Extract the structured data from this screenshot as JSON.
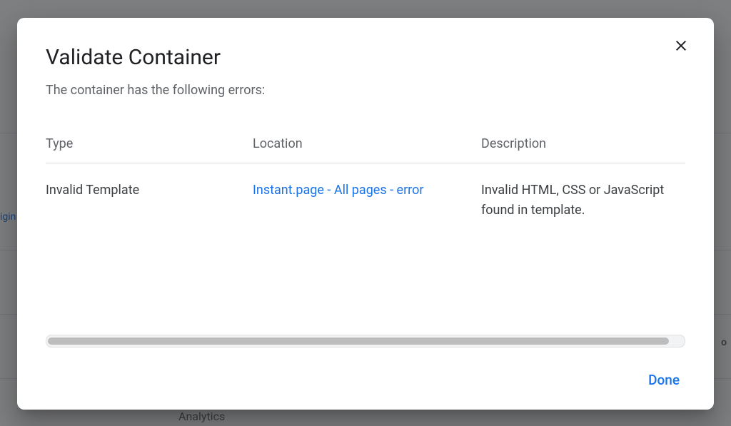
{
  "dialog": {
    "title": "Validate Container",
    "subtitle": "The container has the following errors:",
    "close_label": "Close",
    "headers": {
      "type": "Type",
      "location": "Location",
      "description": "Description"
    },
    "errors": [
      {
        "type": "Invalid Template",
        "location": "Instant.page - All pages - error",
        "description": "Invalid HTML, CSS or JavaScript found in template."
      }
    ],
    "done_label": "Done"
  },
  "background": {
    "left_text": "igin",
    "analytics_label": "Analytics",
    "right_o": "o"
  }
}
